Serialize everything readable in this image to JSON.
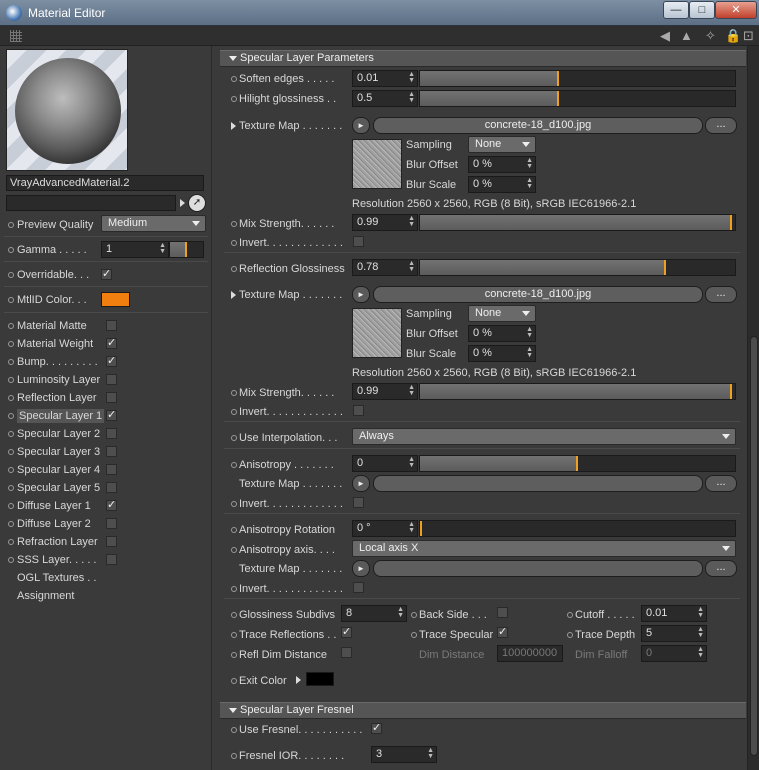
{
  "window": {
    "title": "Material Editor",
    "min": "—",
    "max": "□",
    "close": "✕"
  },
  "left": {
    "material_name": "VrayAdvancedMaterial.2",
    "preview_quality_label": "Preview Quality",
    "preview_quality_value": "Medium",
    "gamma_label": "Gamma . . . . .",
    "gamma_value": "1",
    "overridable_label": "Overridable. . .",
    "mtlid_label": "MtlID Color. . .",
    "mtlid_color": "#f07f10",
    "channels": [
      {
        "label": "Material Matte",
        "checked": ""
      },
      {
        "label": "Material Weight",
        "checked": "✓"
      },
      {
        "label": "Bump. . . . . . . . .",
        "checked": "✓"
      },
      {
        "label": "Luminosity Layer",
        "checked": ""
      },
      {
        "label": "Reflection Layer",
        "checked": ""
      },
      {
        "label": "Specular Layer 1",
        "checked": "✓"
      },
      {
        "label": "Specular Layer 2",
        "checked": ""
      },
      {
        "label": "Specular Layer 3",
        "checked": ""
      },
      {
        "label": "Specular Layer 4",
        "checked": ""
      },
      {
        "label": "Specular Layer 5",
        "checked": ""
      },
      {
        "label": "Diffuse Layer 1",
        "checked": "✓"
      },
      {
        "label": "Diffuse Layer 2",
        "checked": ""
      },
      {
        "label": "Refraction Layer",
        "checked": ""
      },
      {
        "label": "SSS Layer. . . . .",
        "checked": ""
      }
    ],
    "ogl_label": "OGL Textures . .",
    "assignment_label": "Assignment"
  },
  "main": {
    "section1": "Specular Layer Parameters",
    "soften_label": "Soften edges . . . . .",
    "soften_value": "0.01",
    "soften_fill": 0.44,
    "hilight_label": "Hilight glossiness . .",
    "hilight_value": "0.5",
    "hilight_fill": 0.44,
    "tex1_label": "Texture Map . . . . . . .",
    "tex1_file": "concrete-18_d100.jpg",
    "sampling_label": "Sampling",
    "sampling_value": "None",
    "bluroff_label": "Blur Offset",
    "bluroff_value": "0 %",
    "blurscale_label": "Blur Scale",
    "blurscale_value": "0 %",
    "res1": "Resolution 2560 x 2560, RGB (8 Bit), sRGB IEC61966-2.1",
    "mix1_label": "Mix Strength. . . . . .",
    "mix1_value": "0.99",
    "mix1_fill": 0.99,
    "invert_label": "Invert. . . . . . . . . . . . .",
    "refl_gloss_label": "Reflection Glossiness",
    "refl_gloss_value": "0.78",
    "refl_gloss_fill": 0.78,
    "tex2_label": "Texture Map . . . . . . .",
    "tex2_file": "concrete-18_d100.jpg",
    "sampling2_value": "None",
    "bluroff2_value": "0 %",
    "blurscale2_value": "0 %",
    "res2": "Resolution 2560 x 2560, RGB (8 Bit), sRGB IEC61966-2.1",
    "mix2_label": "Mix Strength. . . . . .",
    "mix2_value": "0.99",
    "mix2_fill": 0.99,
    "interp_label": "Use Interpolation. . .",
    "interp_value": "Always",
    "aniso_label": "Anisotropy . . . . . . .",
    "aniso_value": "0",
    "aniso_fill": 0.5,
    "tex3_label": "Texture Map . . . . . . .",
    "aniso_rot_label": "Anisotropy Rotation",
    "aniso_rot_value": "0 °",
    "aniso_axis_label": "Anisotropy axis. . . .",
    "aniso_axis_value": "Local axis X",
    "tex4_label": "Texture Map . . . . . . .",
    "gloss_subdivs_label": "Glossiness Subdivs",
    "gloss_subdivs_value": "8",
    "backside_label": "Back Side . . .",
    "cutoff_label": "Cutoff . . . . .",
    "cutoff_value": "0.01",
    "trace_refl_label": "Trace Reflections . .",
    "trace_spec_label": "Trace Specular",
    "trace_depth_label": "Trace Depth",
    "trace_depth_value": "5",
    "refl_dim_label": "Refl Dim Distance",
    "dim_dist_label": "Dim Distance",
    "dim_dist_value": "100000000",
    "dim_falloff_label": "Dim Falloff",
    "dim_falloff_value": "0",
    "exit_color_label": "Exit Color",
    "exit_color": "#000000",
    "section2": "Specular Layer Fresnel",
    "use_fresnel_label": "Use Fresnel. . . . . . . . . . .",
    "fresnel_ior_label": "Fresnel IOR. . . . . . . .",
    "fresnel_ior_value": "3",
    "dots": "...",
    "arrow_btn": "►"
  },
  "accent": "#f0a020"
}
